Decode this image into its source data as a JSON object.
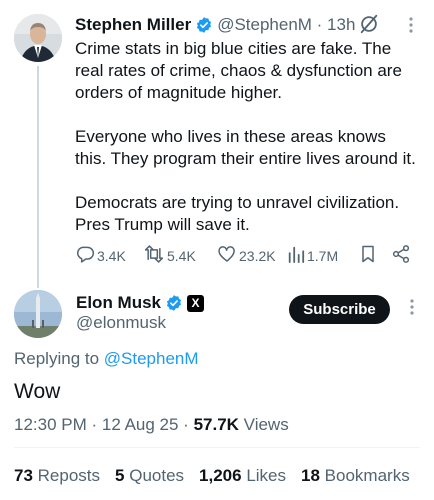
{
  "parent_tweet": {
    "name": "Stephen Miller",
    "handle_time": "@StephenM · 13h",
    "paragraphs": [
      "Crime stats in big blue cities are fake. The real rates of crime, chaos & dysfunction are orders of magnitude higher.",
      "Everyone who lives in these areas knows this. They program their entire lives around it.",
      "Democrats are trying to unravel civilization. Pres Trump will save it."
    ],
    "actions": {
      "replies": "3.4K",
      "reposts": "5.4K",
      "likes": "23.2K",
      "views": "1.7M"
    }
  },
  "reply_tweet": {
    "name": "Elon Musk",
    "x_badge": "X",
    "handle": "@elonmusk",
    "subscribe_label": "Subscribe",
    "replying_prefix": "Replying to ",
    "replying_mention": "@StephenM",
    "text": "Wow",
    "timestamp": "12:30 PM · 12 Aug 25 · ",
    "views_count": "57.7K",
    "views_label": " Views"
  },
  "stats": [
    {
      "count": "73",
      "label": "Reposts"
    },
    {
      "count": "5",
      "label": "Quotes"
    },
    {
      "count": "1,206",
      "label": "Likes"
    },
    {
      "count": "18",
      "label": "Bookmarks"
    }
  ],
  "colors": {
    "text_primary": "#0f1419",
    "text_secondary": "#536471",
    "verified_blue": "#1d9bf0",
    "mention_blue": "#1d9bf0",
    "thread_line": "#cfd9de"
  },
  "icons": {
    "verified": "verified-badge-icon",
    "grok": "grok-icon",
    "more": "more-options-icon",
    "reply": "reply-icon",
    "repost": "repost-icon",
    "like": "like-icon",
    "views": "views-icon",
    "bookmark": "bookmark-icon",
    "share": "share-icon"
  }
}
